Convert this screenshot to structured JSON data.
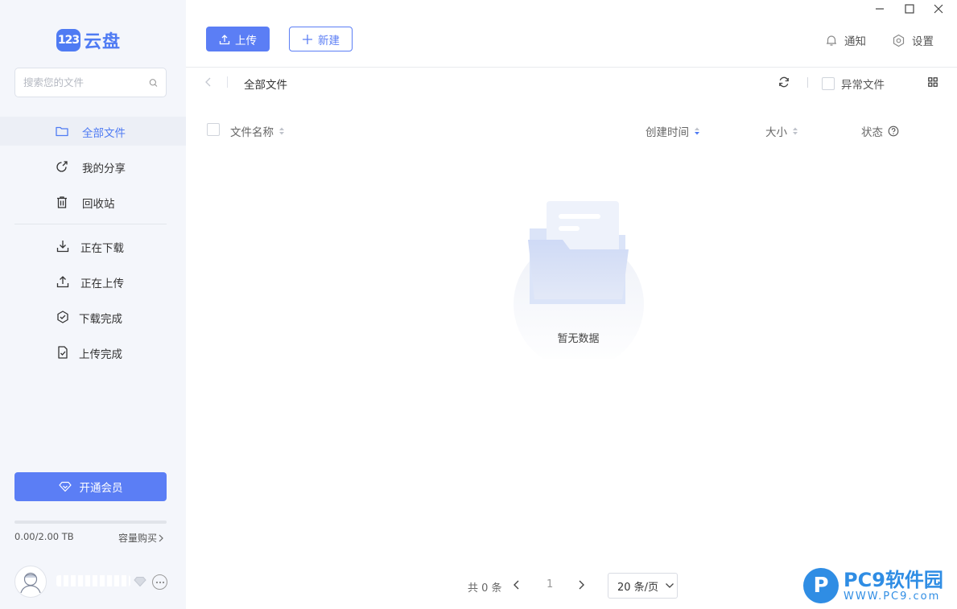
{
  "sidebar": {
    "logo_mark": "123",
    "logo_text": "云盘",
    "search_placeholder": "搜索您的文件",
    "nav": [
      {
        "label": "全部文件",
        "icon": "folder-icon"
      },
      {
        "label": "我的分享",
        "icon": "share-icon"
      },
      {
        "label": "回收站",
        "icon": "trash-icon"
      },
      {
        "label": "正在下载",
        "icon": "download-icon"
      },
      {
        "label": "正在上传",
        "icon": "upload-icon"
      },
      {
        "label": "下载完成",
        "icon": "download-done-icon"
      },
      {
        "label": "上传完成",
        "icon": "upload-done-icon"
      }
    ],
    "vip_label": "开通会员",
    "quota_text": "0.00/2.00 TB",
    "quota_used_fraction": 0,
    "buy_label": "容量购买"
  },
  "toolbar": {
    "upload_label": "上传",
    "new_label": "新建",
    "notify_label": "通知",
    "settings_label": "设置"
  },
  "breadcrumb": {
    "current": "全部文件",
    "abnormal_label": "异常文件"
  },
  "table": {
    "columns": [
      "文件名称",
      "创建时间",
      "大小",
      "状态"
    ]
  },
  "empty": {
    "text": "暂无数据"
  },
  "pager": {
    "total": "共 0 条",
    "page": "1",
    "page_size": "20 条/页"
  },
  "watermark": {
    "icon_letter": "P",
    "title": "PC9软件园",
    "url": "WWW.PC9.com"
  },
  "colors": {
    "accent": "#5b7ef5",
    "sidebar_bg": "#f4f6fb"
  }
}
